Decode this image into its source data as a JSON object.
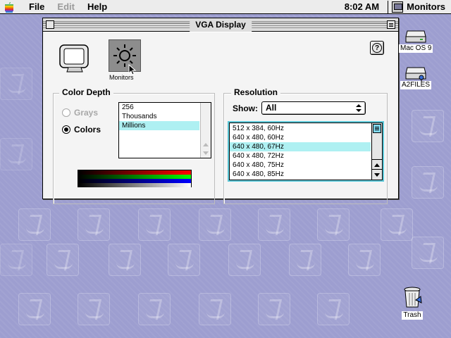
{
  "menubar": {
    "items": [
      "File",
      "Edit",
      "Help"
    ],
    "clock": "8:02 AM",
    "app_name": "Monitors"
  },
  "window": {
    "title": "VGA Display",
    "icons": {
      "monitors_label": "Monitors",
      "help_label": "?"
    },
    "color_depth": {
      "title": "Color Depth",
      "radio_grays": "Grays",
      "radio_colors": "Colors",
      "selected_radio": "Colors",
      "list": [
        "256",
        "Thousands",
        "Millions"
      ],
      "selected": "Millions"
    },
    "resolution": {
      "title": "Resolution",
      "show_label": "Show:",
      "show_value": "All",
      "list": [
        "512 x 384, 60Hz",
        "640 x 480, 60Hz",
        "640 x 480, 67Hz",
        "640 x 480, 72Hz",
        "640 x 480, 75Hz",
        "640 x 480, 85Hz"
      ],
      "selected": "640 x 480, 67Hz"
    }
  },
  "desktop_icons": [
    "Mac OS 9",
    "A2FILES",
    "Trash"
  ],
  "colors": {
    "desktop": "#9d9ed0",
    "selection": "#aef0f2",
    "focus_ring": "#5cc8d8"
  }
}
